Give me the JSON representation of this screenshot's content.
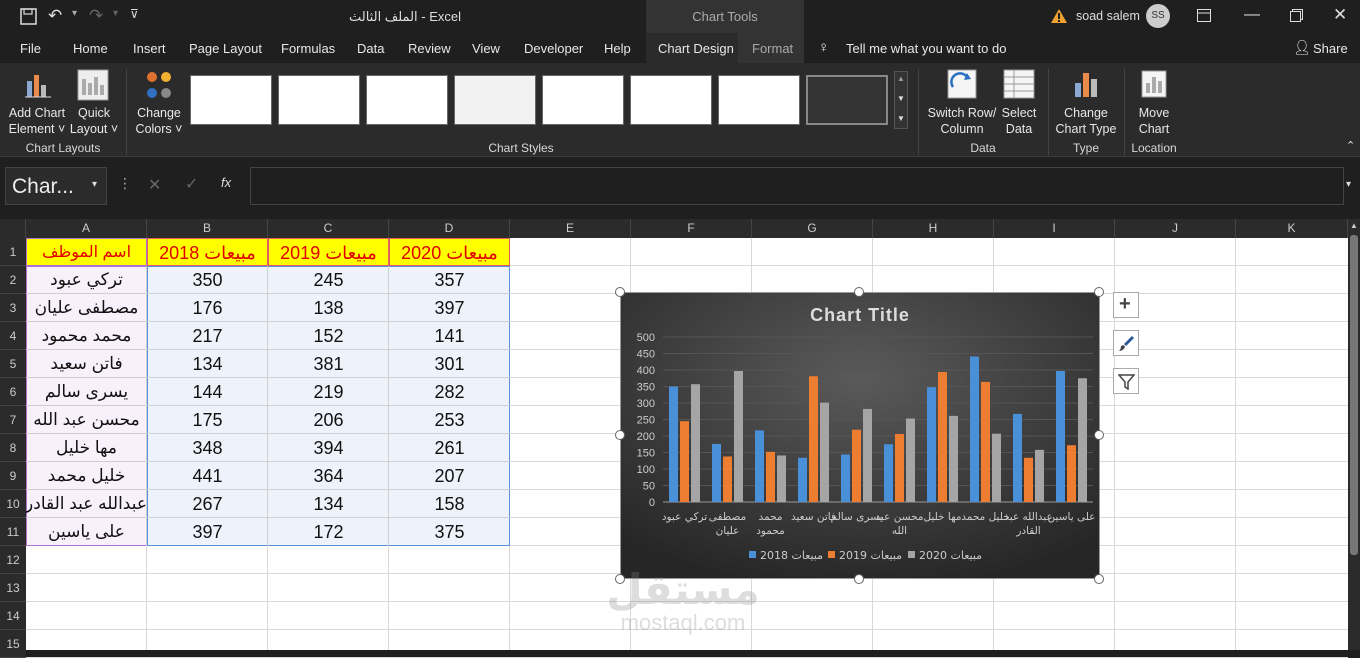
{
  "titlebar": {
    "doc_title": "الملف الثالث  -  Excel",
    "chart_tools": "Chart Tools",
    "user_name": "soad salem",
    "user_initials": "SS"
  },
  "menu": {
    "items": [
      "File",
      "Home",
      "Insert",
      "Page Layout",
      "Formulas",
      "Data",
      "Review",
      "View",
      "Developer",
      "Help",
      "Chart Design",
      "Format"
    ],
    "tell_me": "Tell me what you want to do",
    "share": "Share"
  },
  "ribbon": {
    "add_chart_element": [
      "Add Chart",
      "Element ˅"
    ],
    "quick_layout": [
      "Quick",
      "Layout ˅"
    ],
    "change_colors": [
      "Change",
      "Colors ˅"
    ],
    "switch_row_col": [
      "Switch Row/",
      "Column"
    ],
    "select_data": [
      "Select",
      "Data"
    ],
    "change_chart_type": [
      "Change",
      "Chart Type"
    ],
    "move_chart": [
      "Move",
      "Chart"
    ],
    "groups": {
      "chart_layouts": "Chart Layouts",
      "chart_styles": "Chart Styles",
      "data": "Data",
      "type": "Type",
      "location": "Location"
    }
  },
  "formula_bar": {
    "name_box": "Char...",
    "fx": "fx",
    "value": ""
  },
  "sheet": {
    "columns": [
      "A",
      "B",
      "C",
      "D",
      "E",
      "F",
      "G",
      "H",
      "I",
      "J",
      "K"
    ],
    "rows": [
      "1",
      "2",
      "3",
      "4",
      "5",
      "6",
      "7",
      "8",
      "9",
      "10",
      "11",
      "12",
      "13",
      "14",
      "15"
    ],
    "header": [
      "اسم الموظف",
      "مبيعات 2018",
      "مبيعات 2019",
      "مبيعات 2020"
    ],
    "data": [
      [
        "تركي عبود",
        "350",
        "245",
        "357"
      ],
      [
        "مصطفى عليان",
        "176",
        "138",
        "397"
      ],
      [
        "محمد محمود",
        "217",
        "152",
        "141"
      ],
      [
        "فاتن سعيد",
        "134",
        "381",
        "301"
      ],
      [
        "يسرى سالم",
        "144",
        "219",
        "282"
      ],
      [
        "محسن عبد الله",
        "175",
        "206",
        "253"
      ],
      [
        "مها خليل",
        "348",
        "394",
        "261"
      ],
      [
        "خليل محمد",
        "441",
        "364",
        "207"
      ],
      [
        "عبدالله عبد القادر",
        "267",
        "134",
        "158"
      ],
      [
        "على ياسين",
        "397",
        "172",
        "375"
      ]
    ],
    "header_bg": "#ffff00",
    "header_color": "#e00000",
    "data_bg": "#eef3fb"
  },
  "chart_data": {
    "type": "bar",
    "title": "Chart Title",
    "categories": [
      "تركي عبود",
      "مصطفى عليان",
      "محمد محمود",
      "فاتن سعيد",
      "يسرى سالم",
      "محسن عبد الله",
      "مها خليل",
      "خليل محمد",
      "عبدالله عبد القادر",
      "على ياسين"
    ],
    "series": [
      {
        "name": "مبيعات 2018",
        "values": [
          350,
          176,
          217,
          134,
          144,
          175,
          348,
          441,
          267,
          397
        ],
        "color": "#4a90d9"
      },
      {
        "name": "مبيعات 2019",
        "values": [
          245,
          138,
          152,
          381,
          219,
          206,
          394,
          364,
          134,
          172
        ],
        "color": "#ed7d31"
      },
      {
        "name": "مبيعات 2020",
        "values": [
          357,
          397,
          141,
          301,
          282,
          253,
          261,
          207,
          158,
          375
        ],
        "color": "#a5a5a5"
      }
    ],
    "ylim": [
      0,
      500
    ],
    "yticks": [
      "0",
      "50",
      "100",
      "150",
      "200",
      "250",
      "300",
      "350",
      "400",
      "450",
      "500"
    ],
    "legend": "bottom",
    "grid": true
  },
  "watermark": {
    "text": "mostaql.com",
    "arabic": "مستقل"
  }
}
